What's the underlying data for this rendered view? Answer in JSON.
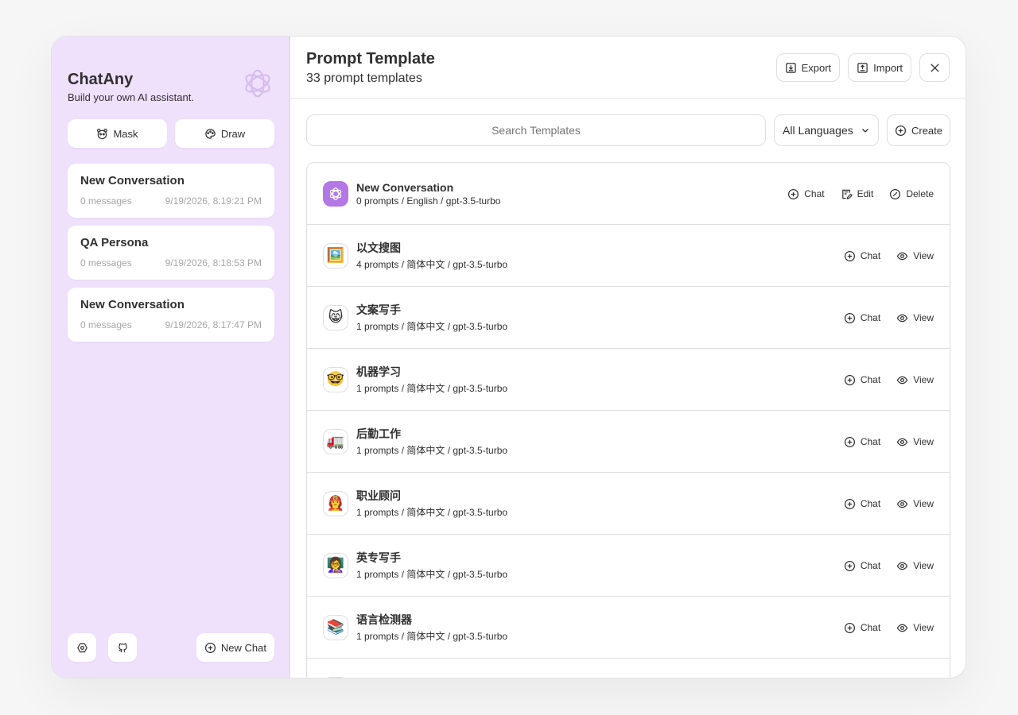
{
  "sidebar": {
    "app_title": "ChatAny",
    "app_subtitle": "Build your own AI assistant.",
    "mask_label": "Mask",
    "draw_label": "Draw",
    "sessions": [
      {
        "title": "New Conversation",
        "count": "0 messages",
        "time": "9/19/2026, 8:19:21 PM"
      },
      {
        "title": "QA Persona",
        "count": "0 messages",
        "time": "9/19/2026, 8:18:53 PM"
      },
      {
        "title": "New Conversation",
        "count": "0 messages",
        "time": "9/19/2026, 8:17:47 PM"
      }
    ],
    "new_chat_label": "New Chat"
  },
  "header": {
    "title": "Prompt Template",
    "subtitle": "33 prompt templates",
    "export_label": "Export",
    "import_label": "Import"
  },
  "toolbar": {
    "search_placeholder": "Search Templates",
    "language_value": "All Languages",
    "create_label": "Create"
  },
  "templates": [
    {
      "name": "New Conversation",
      "meta": "0 prompts / English / gpt-3.5-turbo",
      "avatar": "ai-logo",
      "chat_label": "Chat",
      "edit_label": "Edit",
      "delete_label": "Delete"
    },
    {
      "name": "以文搜图",
      "meta": "4 prompts / 简体中文 / gpt-3.5-turbo",
      "avatar": "🖼️",
      "chat_label": "Chat",
      "view_label": "View"
    },
    {
      "name": "文案写手",
      "meta": "1 prompts / 简体中文 / gpt-3.5-turbo",
      "avatar": "😸",
      "chat_label": "Chat",
      "view_label": "View"
    },
    {
      "name": "机器学习",
      "meta": "1 prompts / 简体中文 / gpt-3.5-turbo",
      "avatar": "🤓",
      "chat_label": "Chat",
      "view_label": "View"
    },
    {
      "name": "后勤工作",
      "meta": "1 prompts / 简体中文 / gpt-3.5-turbo",
      "avatar": "🚛",
      "chat_label": "Chat",
      "view_label": "View"
    },
    {
      "name": "职业顾问",
      "meta": "1 prompts / 简体中文 / gpt-3.5-turbo",
      "avatar": "👩‍🚒",
      "chat_label": "Chat",
      "view_label": "View"
    },
    {
      "name": "英专写手",
      "meta": "1 prompts / 简体中文 / gpt-3.5-turbo",
      "avatar": "👩‍🏫",
      "chat_label": "Chat",
      "view_label": "View"
    },
    {
      "name": "语言检测器",
      "meta": "1 prompts / 简体中文 / gpt-3.5-turbo",
      "avatar": "📚",
      "chat_label": "Chat",
      "view_label": "View"
    }
  ],
  "colors": {
    "sidebar_bg": "#efe0fc",
    "accent": "#b477e6",
    "text": "#303030",
    "muted": "#a6a6a6",
    "border": "#dedede"
  }
}
